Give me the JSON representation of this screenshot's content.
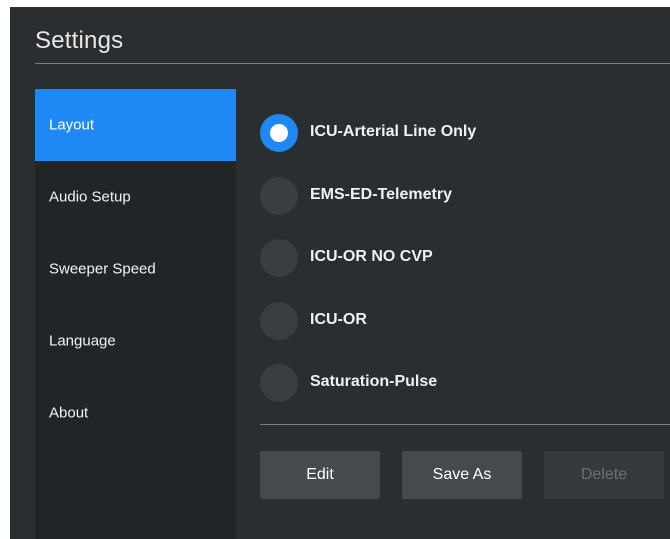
{
  "window": {
    "title": "Settings"
  },
  "sidebar": {
    "items": [
      {
        "label": "Layout",
        "active": true
      },
      {
        "label": "Audio Setup",
        "active": false
      },
      {
        "label": "Sweeper Speed",
        "active": false
      },
      {
        "label": "Language",
        "active": false
      },
      {
        "label": "About",
        "active": false
      }
    ]
  },
  "layouts": {
    "options": [
      {
        "label": "ICU-Arterial Line Only",
        "selected": true
      },
      {
        "label": "EMS-ED-Telemetry",
        "selected": false
      },
      {
        "label": "ICU-OR NO CVP",
        "selected": false
      },
      {
        "label": "ICU-OR",
        "selected": false
      },
      {
        "label": "Saturation-Pulse",
        "selected": false
      }
    ]
  },
  "actions": {
    "edit_label": "Edit",
    "save_as_label": "Save As",
    "delete_label": "Delete",
    "delete_enabled": false
  },
  "colors": {
    "accent": "#1e88f5",
    "background": "#2b2e31",
    "sidebar": "#222528",
    "button": "#464a4e"
  }
}
